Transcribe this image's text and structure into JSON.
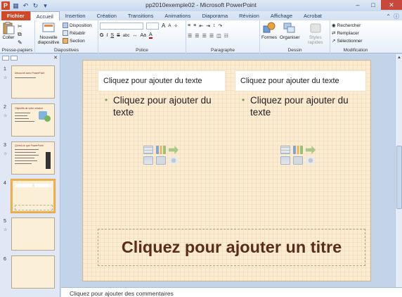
{
  "window": {
    "title": "pp2010exemple02 - Microsoft PowerPoint",
    "logo_letter": "P"
  },
  "tabs": [
    "Fichier",
    "Accueil",
    "Insertion",
    "Création",
    "Transitions",
    "Animations",
    "Diaporama",
    "Révision",
    "Affichage",
    "Acrobat"
  ],
  "ribbon": {
    "clipboard": {
      "paste": "Coller",
      "label": "Presse-papiers"
    },
    "slides": {
      "new_slide": "Nouvelle diapositive",
      "layout": "Disposition",
      "reset": "Rétablir",
      "section": "Section",
      "label": "Diapositives"
    },
    "font": {
      "bold": "G",
      "italic": "I",
      "underline": "S",
      "strike": "S",
      "shadow": "abc",
      "font_size_up": "A",
      "font_size_down": "A",
      "label": "Police"
    },
    "paragraph": {
      "label": "Paragraphe"
    },
    "drawing": {
      "shapes": "Formes",
      "arrange": "Organiser",
      "styles": "Styles rapides",
      "label": "Dessin"
    },
    "editing": {
      "find": "Rechercher",
      "replace": "Remplacer",
      "select": "Sélectionner",
      "label": "Modification"
    }
  },
  "thumbnails": [
    {
      "num": "1",
      "title": "Découvrir avec PowerPoint"
    },
    {
      "num": "2",
      "title": "Objectifs de votre mission"
    },
    {
      "num": "3",
      "title": "Qu'est-ce que PowerPoint"
    },
    {
      "num": "4",
      "title": ""
    },
    {
      "num": "5",
      "title": ""
    },
    {
      "num": "6",
      "title": ""
    }
  ],
  "slide": {
    "left_heading": "Cliquez pour ajouter du texte",
    "left_bullet": "Cliquez pour ajouter du texte",
    "right_heading": "Cliquez pour ajouter du texte",
    "right_bullet": "Cliquez pour ajouter du texte",
    "title": "Cliquez pour ajouter un titre"
  },
  "notes": {
    "placeholder": "Cliquez pour ajouter des commentaires"
  },
  "colors": {
    "file_tab": "#d24726",
    "slide_bg": "#fbecd2",
    "title_text": "#5b2b1c",
    "bullet": "#7a9a58"
  }
}
